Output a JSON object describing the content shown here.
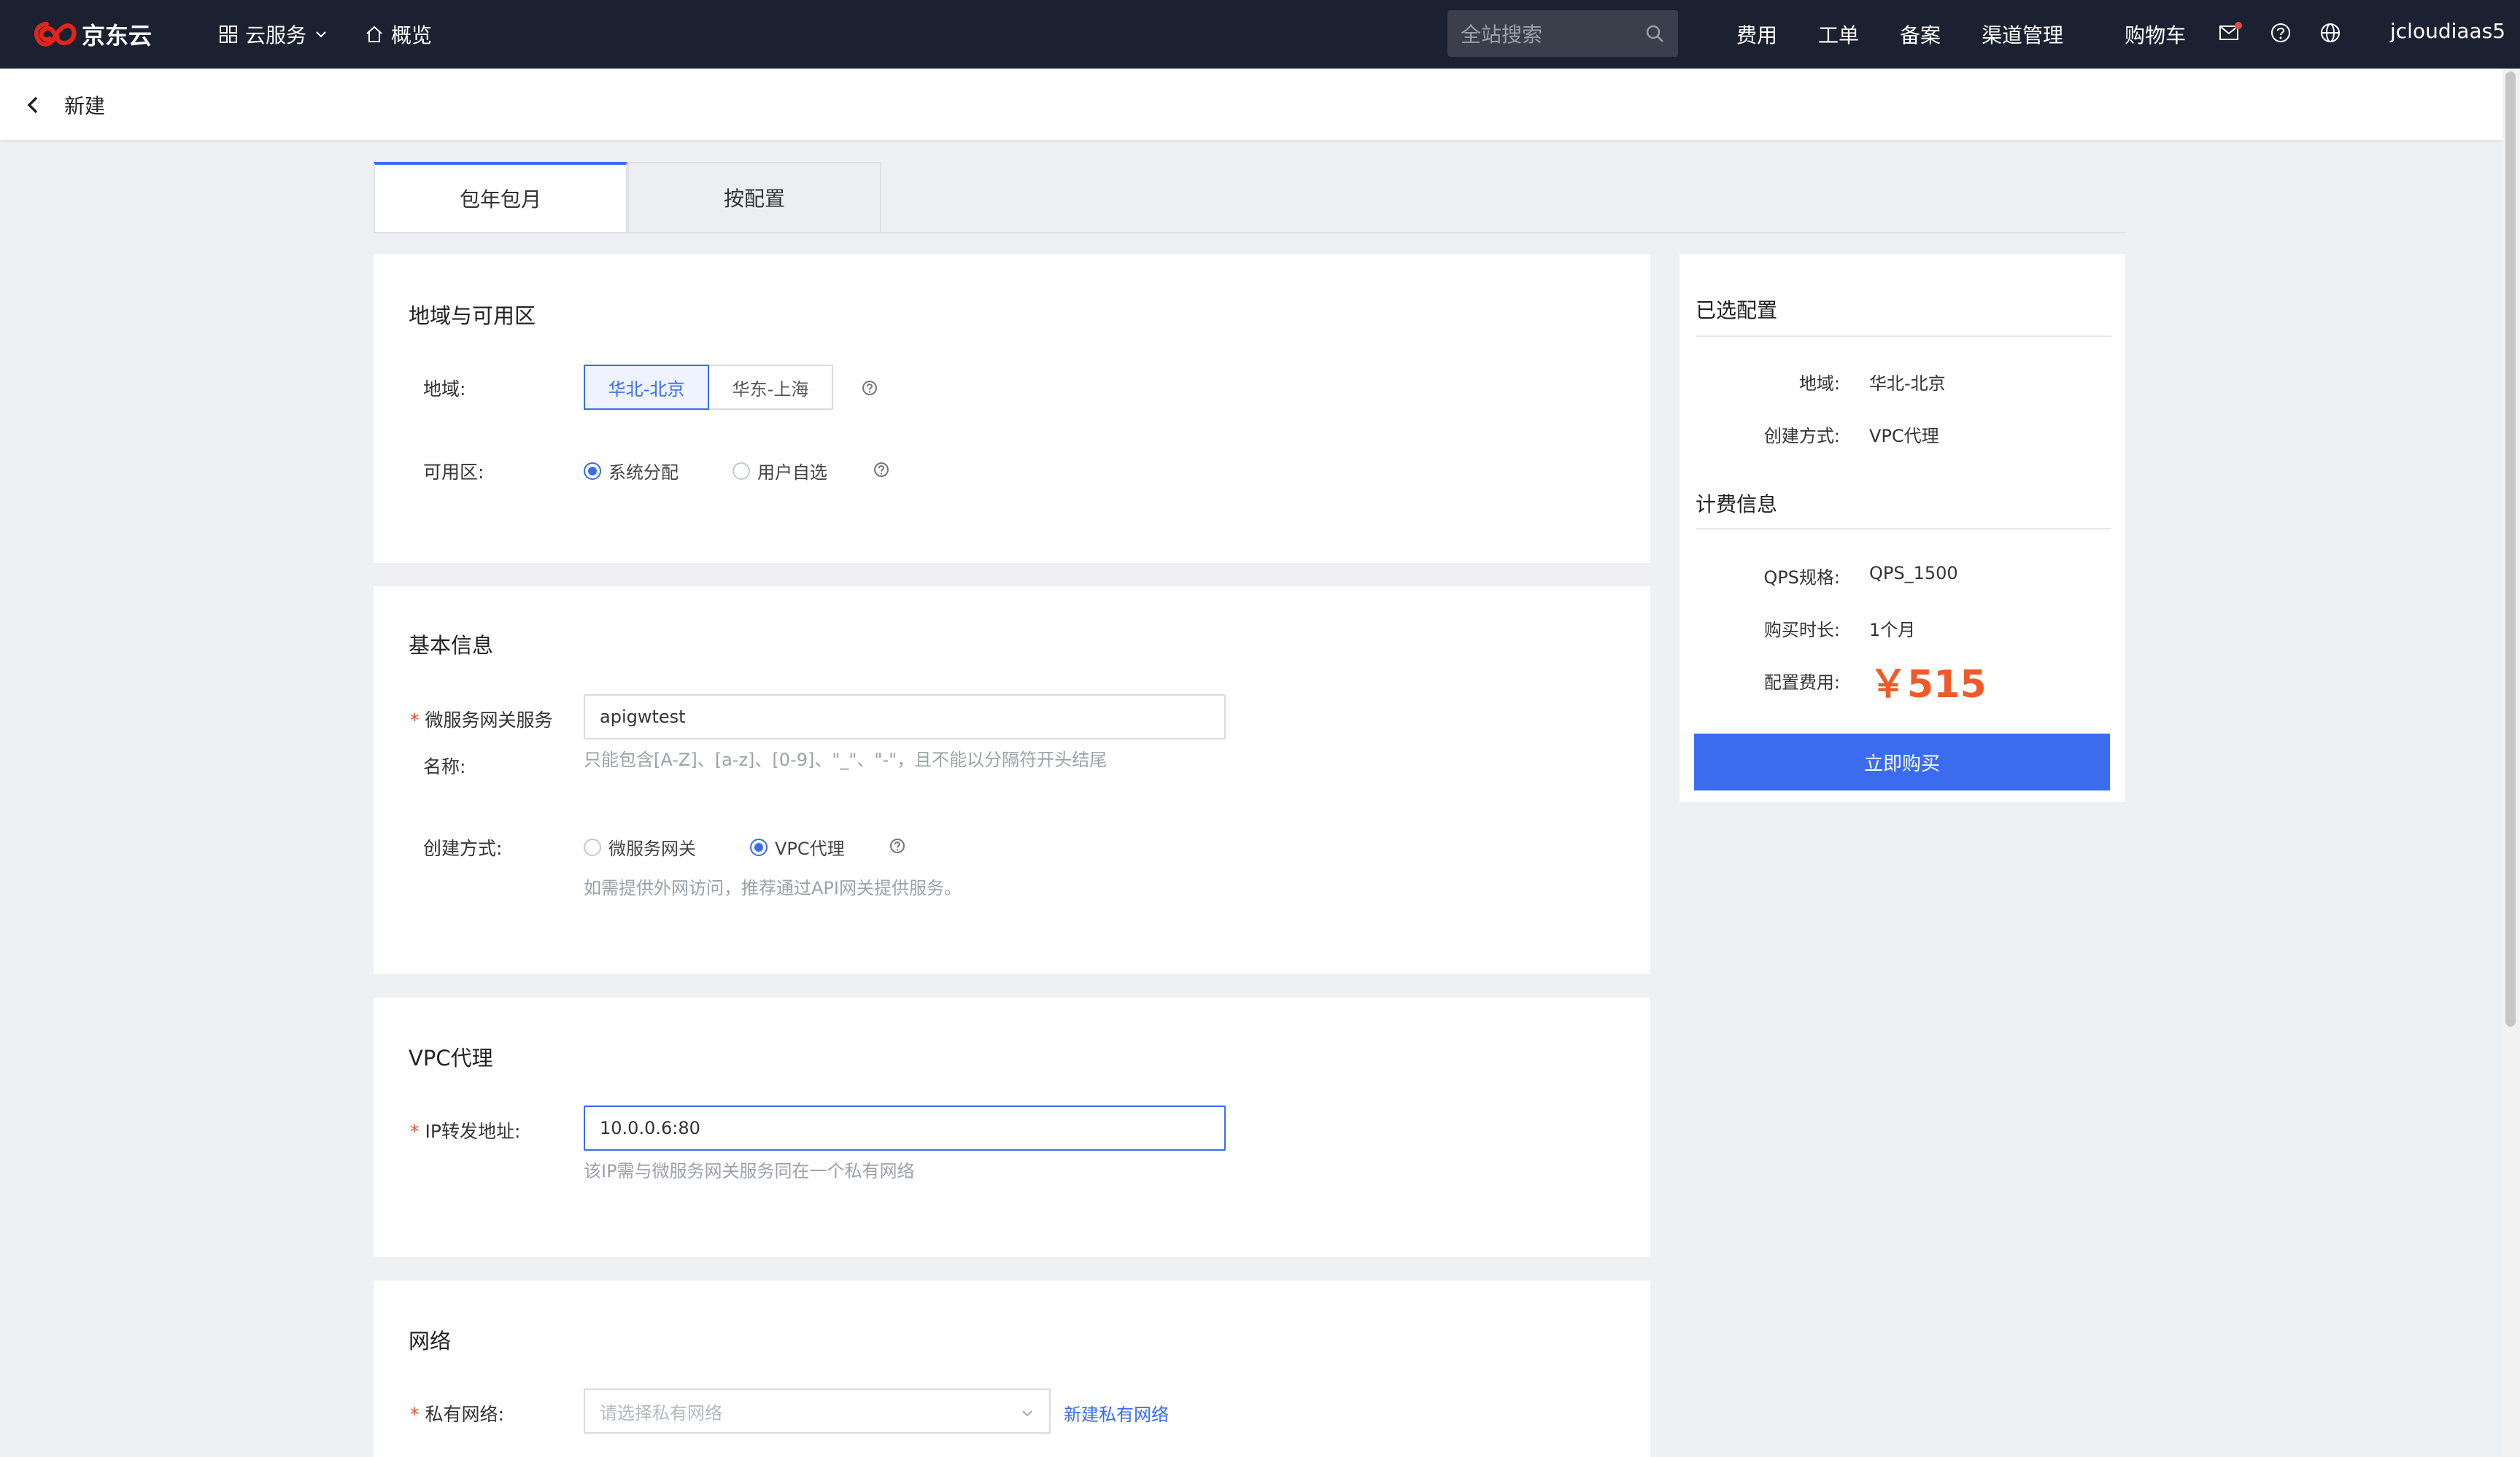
{
  "brand": {
    "name": "京东云",
    "color": "#e1251b"
  },
  "nav": {
    "cloud_services": "云服务",
    "overview": "概览",
    "search_placeholder": "全站搜索",
    "items": [
      "费用",
      "工单",
      "备案",
      "渠道管理",
      "购物车"
    ],
    "user": "jcloudiaas5"
  },
  "subheader": {
    "title": "新建"
  },
  "tabs": [
    "包年包月",
    "按配置"
  ],
  "region_section": {
    "title": "地域与可用区",
    "region_label": "地域:",
    "regions": [
      "华北-北京",
      "华东-上海"
    ],
    "selected_region": "华北-北京",
    "zone_label": "可用区:",
    "zone_options": [
      "系统分配",
      "用户自选"
    ],
    "selected_zone": "系统分配"
  },
  "basic_section": {
    "title": "基本信息",
    "name_label_line1": "微服务网关服务",
    "name_label_line2": "名称:",
    "name_value": "apigwtest",
    "name_hint": "只能包含[A-Z]、[a-z]、[0-9]、\"_\"、\"-\"，且不能以分隔符开头结尾",
    "create_label": "创建方式:",
    "create_options": [
      "微服务网关",
      "VPC代理"
    ],
    "selected_create": "VPC代理",
    "create_hint": "如需提供外网访问，推荐通过API网关提供服务。"
  },
  "vpc_section": {
    "title": "VPC代理",
    "ip_label": "IP转发地址:",
    "ip_value": "10.0.0.6:80",
    "ip_hint": "该IP需与微服务网关服务同在一个私有网络"
  },
  "network_section": {
    "title": "网络",
    "vpc_label": "私有网络:",
    "vpc_placeholder": "请选择私有网络",
    "create_link": "新建私有网络"
  },
  "summary": {
    "selected_title": "已选配置",
    "region_key": "地域:",
    "region_value": "华北-北京",
    "create_key": "创建方式:",
    "create_value": "VPC代理",
    "billing_title": "计费信息",
    "qps_key": "QPS规格:",
    "qps_value": "QPS_1500",
    "duration_key": "购买时长:",
    "duration_value": "1个月",
    "fee_key": "配置费用:",
    "fee_value": "￥515",
    "buy_label": "立即购买"
  },
  "colors": {
    "primary": "#3b6cf0",
    "price": "#f05a28",
    "topbar": "#1b2130"
  }
}
